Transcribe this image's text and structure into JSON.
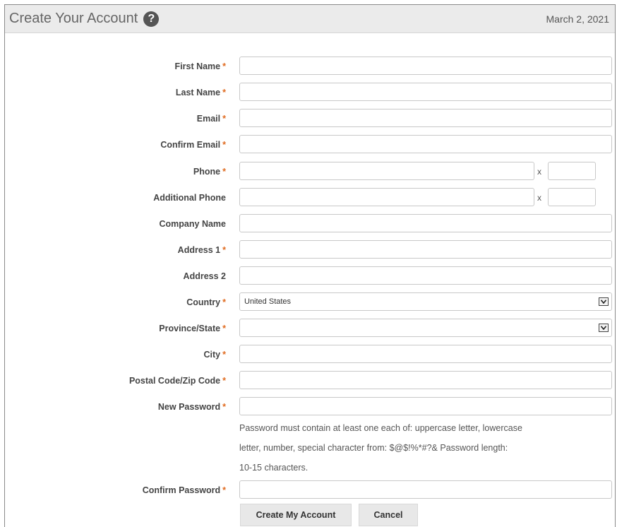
{
  "header": {
    "title": "Create Your Account",
    "help_glyph": "?",
    "date": "March 2, 2021"
  },
  "required_mark": "*",
  "fields": {
    "first_name": "First Name",
    "last_name": "Last Name",
    "email": "Email",
    "confirm_email": "Confirm Email",
    "phone": "Phone",
    "additional_phone": "Additional Phone",
    "company_name": "Company Name",
    "address1": "Address 1",
    "address2": "Address 2",
    "country": "Country",
    "province_state": "Province/State",
    "city": "City",
    "postal_code": "Postal Code/Zip Code",
    "new_password": "New Password",
    "confirm_password": "Confirm Password"
  },
  "ext_label": "x",
  "country_value": "United States",
  "province_value": "",
  "password_help": {
    "line1": "Password must contain at least one each of: uppercase letter, lowercase",
    "line2": "letter, number, special character from: $@$!%*#?& Password length:",
    "line3": "10-15 characters."
  },
  "buttons": {
    "create": "Create My Account",
    "cancel": "Cancel"
  },
  "colors": {
    "required": "#e06b20",
    "header_bg": "#ebebeb"
  }
}
